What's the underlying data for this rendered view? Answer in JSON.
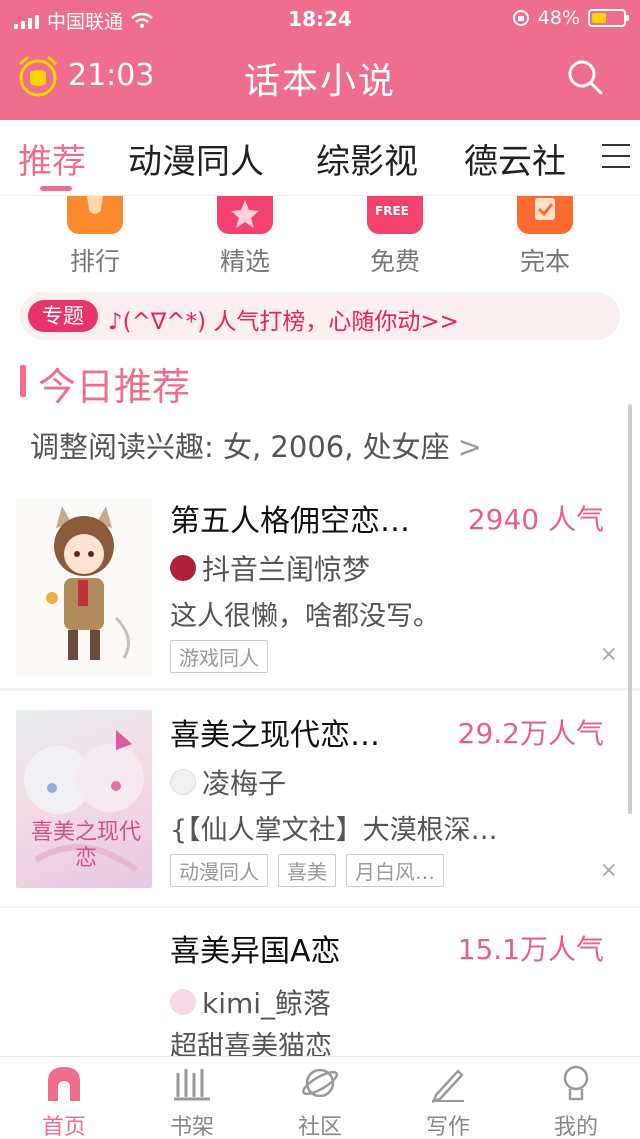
{
  "status_bar": {
    "carrier": "中国联通",
    "time": "18:24",
    "battery": "48%",
    "battery_level": 0.48
  },
  "header": {
    "alarm_time": "21:03",
    "title": "话本小说"
  },
  "tabs": [
    {
      "label": "推荐",
      "active": true
    },
    {
      "label": "动漫同人"
    },
    {
      "label": "综影视"
    },
    {
      "label": "德云社"
    }
  ],
  "shortcuts": [
    {
      "label": "排行",
      "icon": "trophy-icon"
    },
    {
      "label": "精选",
      "icon": "star-icon"
    },
    {
      "label": "免费",
      "icon": "free-icon",
      "badge": "FREE"
    },
    {
      "label": "完本",
      "icon": "check-icon"
    }
  ],
  "topic": {
    "badge": "专题",
    "text": "♪(^∇^*) 人气打榜，心随你动>>"
  },
  "section": {
    "title": "今日推荐",
    "interest": "调整阅读兴趣: 女, 2006, 处女座",
    "interest_chevron": ">"
  },
  "books": [
    {
      "title": "第五人格佣空恋…",
      "popularity": "2940 人气",
      "author": "抖音兰闺惊梦",
      "description": "这人很懒，啥都没写。",
      "tags": [
        "游戏同人"
      ]
    },
    {
      "title": "喜美之现代恋…",
      "popularity": "29.2万人气",
      "author": "凌梅子",
      "description": "{【仙人掌文社】大漠根深…",
      "tags": [
        "动漫同人",
        "喜美",
        "月白风…"
      ],
      "cover_text": "喜美之现代恋"
    },
    {
      "title": "喜美异国A恋",
      "popularity": "15.1万人气",
      "author": "kimi_鲸落",
      "description": "超甜喜美猫恋",
      "tags": []
    }
  ],
  "bottom_nav": [
    {
      "label": "首页",
      "icon": "home-icon",
      "active": true
    },
    {
      "label": "书架",
      "icon": "bookshelf-icon"
    },
    {
      "label": "社区",
      "icon": "planet-icon"
    },
    {
      "label": "写作",
      "icon": "pen-icon"
    },
    {
      "label": "我的",
      "icon": "profile-icon"
    }
  ],
  "colors": {
    "brand": "#f06e8d",
    "accent": "#e8336b"
  },
  "close_symbol": "×"
}
